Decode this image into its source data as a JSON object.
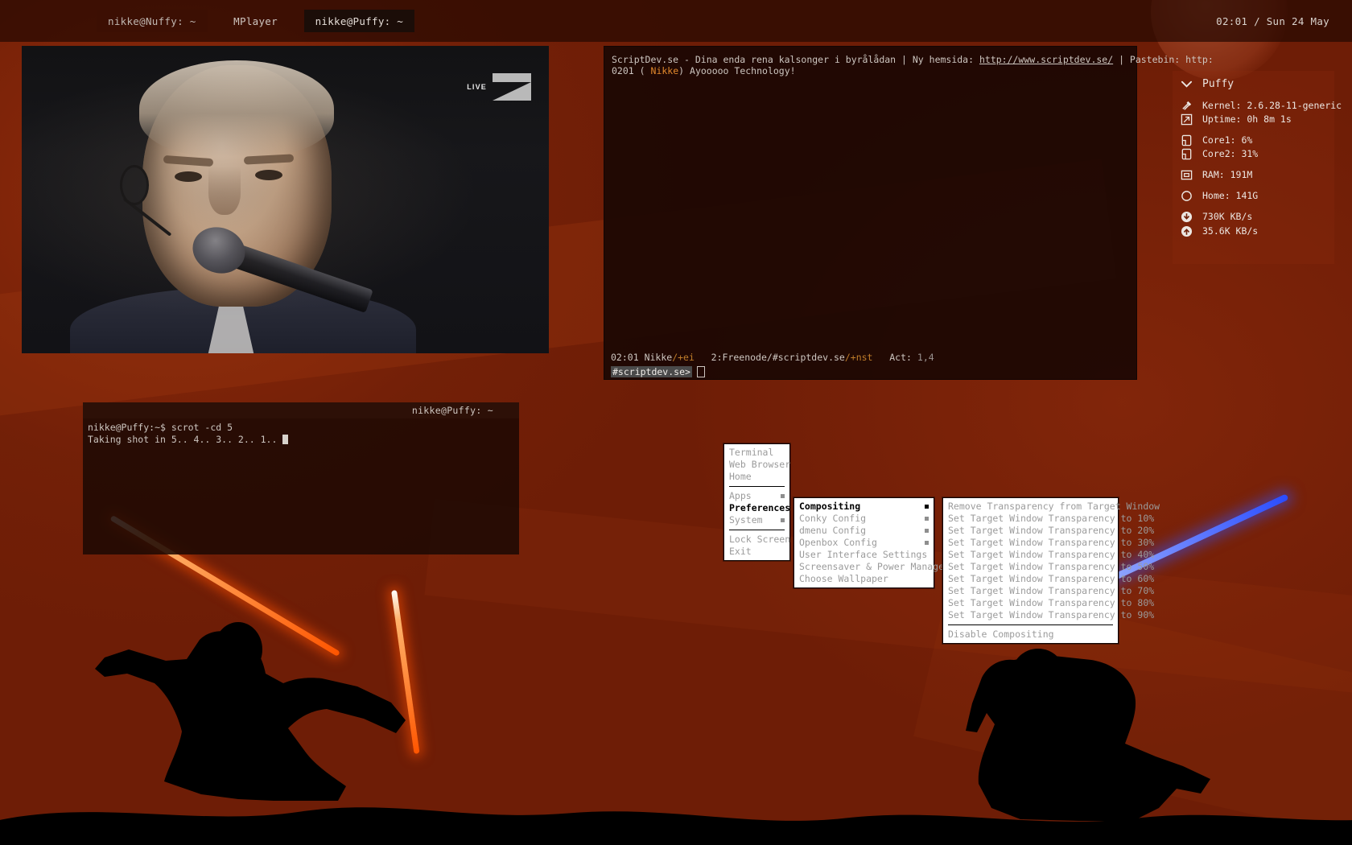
{
  "panel": {
    "tasks": [
      {
        "label": "nikke@Nuffy: ~",
        "state": "normal"
      },
      {
        "label": "MPlayer",
        "state": "plain"
      },
      {
        "label": "nikke@Puffy: ~",
        "state": "active"
      }
    ],
    "clock": "02:01 / Sun 24 May"
  },
  "mplayer": {
    "window_name": "MPlayer",
    "overlay_live": "LIVE",
    "overlay_channel": "7"
  },
  "irc": {
    "topic_prefix": "ScriptDev.se - Dina enda rena kalsonger i byrålådan | Ny hemsida: ",
    "topic_link": "http://www.scriptdev.se/",
    "topic_suffix": " | Pastebin: http:",
    "message_time": "0201",
    "message_open": "(",
    "message_nick": "Nikke",
    "message_close": ")",
    "message_text": "Ayooooo Technology!",
    "status_time": "02:01",
    "status_nick": "Nikke",
    "status_usermode": "/+ei",
    "status_channel": "2:Freenode/#scriptdev.se",
    "status_chanmode": "/+nst",
    "status_act_label": "Act:",
    "status_act_value": "1,4",
    "input_prompt": "#scriptdev.se>",
    "input_value": ""
  },
  "terminal": {
    "title": "nikke@Puffy: ~",
    "line1": "nikke@Puffy:~$ scrot -cd 5",
    "line2": "Taking shot in 5.. 4.. 3.. 2.. 1.. "
  },
  "conky": {
    "host": "Puffy",
    "rows": [
      {
        "icon": "kernel-icon",
        "label": "Kernel: 2.6.28-11-generic"
      },
      {
        "icon": "uptime-icon",
        "label": "Uptime: 0h 8m 1s"
      },
      {
        "icon": "cpu-icon",
        "label": "Core1: 6%"
      },
      {
        "icon": "cpu-icon",
        "label": "Core2: 31%"
      },
      {
        "icon": "ram-icon",
        "label": "RAM:  191M"
      },
      {
        "icon": "disk-icon",
        "label": "Home:  141G"
      },
      {
        "icon": "download-icon",
        "label": "730K KB/s"
      },
      {
        "icon": "upload-icon",
        "label": "35.6K KB/s"
      }
    ]
  },
  "menus": {
    "root": {
      "items": [
        {
          "label": "Terminal",
          "submenu": false,
          "selected": false
        },
        {
          "label": "Web Browser",
          "submenu": false,
          "selected": false
        },
        {
          "label": "Home",
          "submenu": false,
          "selected": false
        },
        {
          "separator": true
        },
        {
          "label": "Apps",
          "submenu": true,
          "selected": false
        },
        {
          "label": "Preferences",
          "submenu": true,
          "selected": true
        },
        {
          "label": "System",
          "submenu": true,
          "selected": false
        },
        {
          "separator": true
        },
        {
          "label": "Lock Screen",
          "submenu": false,
          "selected": false
        },
        {
          "label": "Exit",
          "submenu": false,
          "selected": false
        }
      ]
    },
    "preferences": {
      "items": [
        {
          "label": "Compositing",
          "submenu": true,
          "selected": true
        },
        {
          "label": "Conky Config",
          "submenu": true,
          "selected": false
        },
        {
          "label": "dmenu Config",
          "submenu": true,
          "selected": false
        },
        {
          "label": "Openbox Config",
          "submenu": true,
          "selected": false
        },
        {
          "label": "User Interface Settings",
          "submenu": false,
          "selected": false
        },
        {
          "label": "Screensaver & Power Management",
          "submenu": false,
          "selected": false
        },
        {
          "label": "Choose Wallpaper",
          "submenu": false,
          "selected": false
        }
      ]
    },
    "compositing": {
      "items": [
        {
          "label": "Remove Transparency from Target Window",
          "submenu": false,
          "selected": false
        },
        {
          "label": "Set Target Window Transparency to 10%",
          "submenu": false,
          "selected": false
        },
        {
          "label": "Set Target Window Transparency to 20%",
          "submenu": false,
          "selected": false
        },
        {
          "label": "Set Target Window Transparency to 30%",
          "submenu": false,
          "selected": false
        },
        {
          "label": "Set Target Window Transparency to 40%",
          "submenu": false,
          "selected": false
        },
        {
          "label": "Set Target Window Transparency to 50%",
          "submenu": false,
          "selected": false
        },
        {
          "label": "Set Target Window Transparency to 60%",
          "submenu": false,
          "selected": false
        },
        {
          "label": "Set Target Window Transparency to 70%",
          "submenu": false,
          "selected": false
        },
        {
          "label": "Set Target Window Transparency to 80%",
          "submenu": false,
          "selected": false
        },
        {
          "label": "Set Target Window Transparency to 90%",
          "submenu": false,
          "selected": false
        },
        {
          "separator": true
        },
        {
          "label": "Disable Compositing",
          "submenu": false,
          "selected": false
        }
      ]
    }
  },
  "colors": {
    "desktop_red": "#6e1d06",
    "panel_dark": "#260902",
    "menu_bg": "#ffffff",
    "menu_text": "#9b9b9b",
    "menu_selected_text": "#000000",
    "term_text": "#cdc6c0",
    "irc_nick": "#e3892c",
    "saber_red": "#ff4400",
    "saber_blue": "#2a4cff"
  }
}
